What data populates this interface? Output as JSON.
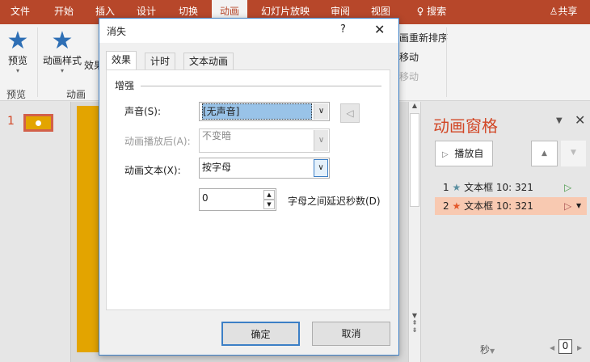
{
  "ribbon_tabs": [
    "文件",
    "开始",
    "插入",
    "设计",
    "切换",
    "动画",
    "幻灯片放映",
    "审阅",
    "视图"
  ],
  "search_label": "搜索",
  "share_label": "共享",
  "ribbon": {
    "preview_btn": "预览",
    "preview_group": "预览",
    "anim_style_btn": "动画样式",
    "effect_btn": "效果",
    "anim_group": "动画",
    "reorder": "对动画重新排序",
    "move_earlier": "向前移动",
    "move_later": "向后移动"
  },
  "thumbs": {
    "slide_number": "1"
  },
  "dialog": {
    "title": "消失",
    "help": "?",
    "tabs": [
      "效果",
      "计时",
      "文本动画"
    ],
    "section": "增强",
    "sound_label": "声音(S):",
    "sound_value": "[无声音]",
    "after_label": "动画播放后(A):",
    "after_value": "不变暗",
    "text_label": "动画文本(X):",
    "text_value": "按字母",
    "delay_value": "0",
    "delay_label": "字母之间延迟秒数(D)",
    "ok": "确定",
    "cancel": "取消"
  },
  "pane": {
    "title": "动画窗格",
    "play_from": "播放自",
    "items": [
      {
        "num": "1",
        "name": "文本框 10: 321",
        "color": "#5b8fa0"
      },
      {
        "num": "2",
        "name": "文本框 10: 321",
        "color": "#e4582a"
      }
    ],
    "seconds": "秒",
    "zoom_value": "0"
  }
}
